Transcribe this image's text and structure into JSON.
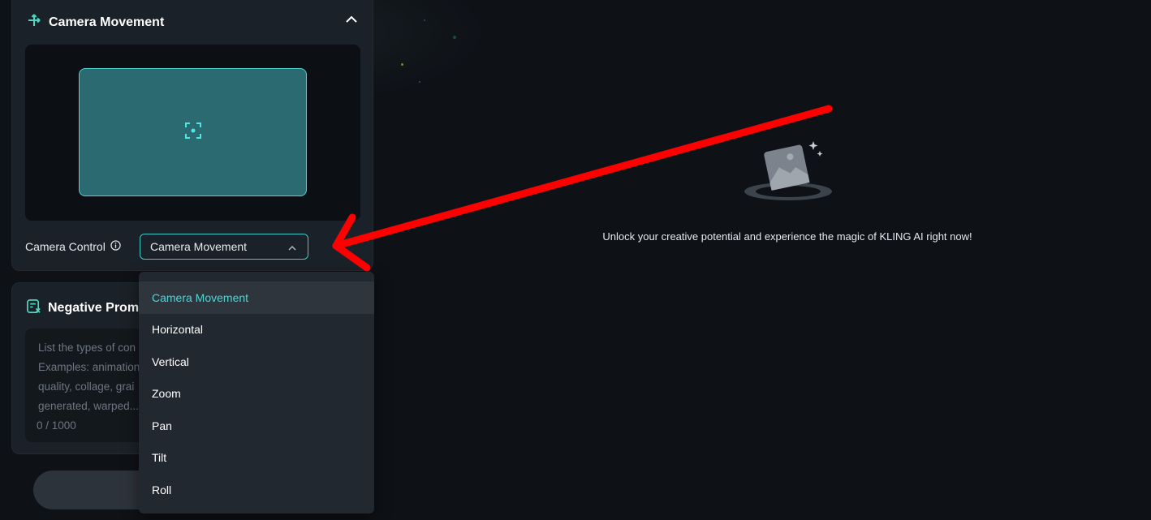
{
  "camera_panel": {
    "title": "Camera Movement",
    "control_label": "Camera Control",
    "selected_value": "Camera Movement"
  },
  "negative_panel": {
    "title": "Negative Promp",
    "placeholder_lines": [
      "List the types of con",
      "Examples: animation",
      "quality, collage, grai",
      "generated, warped..."
    ],
    "counter": "0 / 1000"
  },
  "dropdown": {
    "options": [
      "Camera Movement",
      "Horizontal",
      "Vertical",
      "Zoom",
      "Pan",
      "Tilt",
      "Roll"
    ],
    "selected_index": 0
  },
  "empty_state": {
    "message": "Unlock your creative potential and experience the magic of KLING AI right now!"
  },
  "colors": {
    "accent": "#4fd6d6",
    "annotation_arrow": "#ff0000",
    "background": "#0e1116",
    "panel": "#1b2128"
  },
  "icons": {
    "camera_panel": "camera-move-icon",
    "collapse": "chevron-up-icon",
    "preview_center": "focus-target-icon",
    "info": "info-icon",
    "select_arrow": "chevron-up-icon",
    "negative_panel": "negative-prompt-icon",
    "empty_state": "image-portal-icon"
  }
}
